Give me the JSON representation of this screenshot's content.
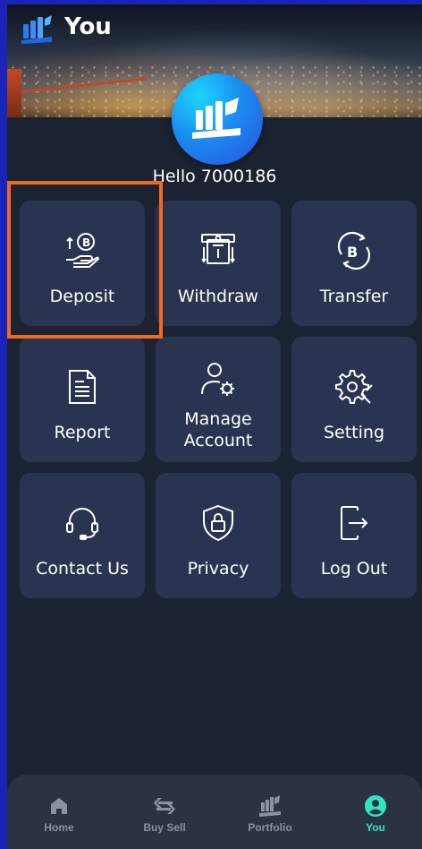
{
  "header": {
    "title": "You"
  },
  "profile": {
    "greeting": "Hello 7000186"
  },
  "menu": {
    "items": [
      {
        "label": "Deposit",
        "icon": "deposit-coin-hand-icon"
      },
      {
        "label": "Withdraw",
        "icon": "atm-withdraw-icon"
      },
      {
        "label": "Transfer",
        "icon": "bitcoin-exchange-icon"
      },
      {
        "label": "Report",
        "icon": "document-report-icon"
      },
      {
        "label": "Manage Account",
        "icon": "user-gear-icon"
      },
      {
        "label": "Setting",
        "icon": "gear-wrench-icon"
      },
      {
        "label": "Contact Us",
        "icon": "headset-icon"
      },
      {
        "label": "Privacy",
        "icon": "shield-lock-icon"
      },
      {
        "label": "Log Out",
        "icon": "logout-door-icon"
      }
    ]
  },
  "highlight": {
    "target": "Deposit",
    "color": "#f26a1b"
  },
  "bottom_nav": {
    "items": [
      {
        "label": "Home",
        "icon": "home-icon"
      },
      {
        "label": "Buy Sell",
        "icon": "swap-arrows-icon"
      },
      {
        "label": "Portfolio",
        "icon": "portfolio-logo-icon"
      },
      {
        "label": "You",
        "icon": "user-circle-icon",
        "active": true
      }
    ]
  },
  "colors": {
    "background": "#1b2231",
    "tile": "#2a3350",
    "accent": "#2ee6c0",
    "frame": "#1a24b8"
  }
}
